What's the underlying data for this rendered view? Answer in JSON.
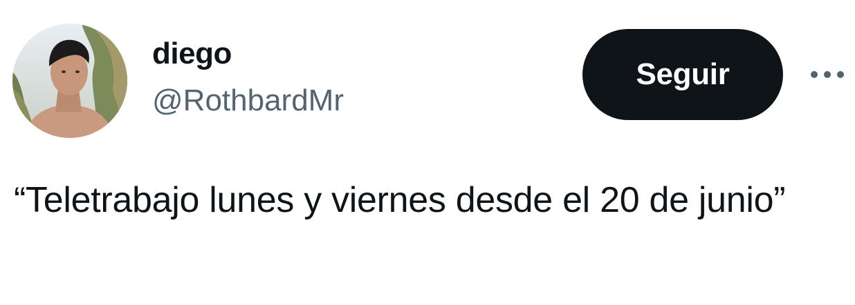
{
  "user": {
    "display_name": "diego",
    "handle": "@RothbardMr",
    "avatar_icon": "profile-photo"
  },
  "actions": {
    "follow_label": "Seguir",
    "more_icon": "more-horizontal-icon"
  },
  "tweet": {
    "text": "“Teletrabajo lunes y viernes desde el 20 de junio”"
  },
  "colors": {
    "text": "#0f1419",
    "secondary": "#536471",
    "button_bg": "#0f1419",
    "button_text": "#ffffff"
  }
}
